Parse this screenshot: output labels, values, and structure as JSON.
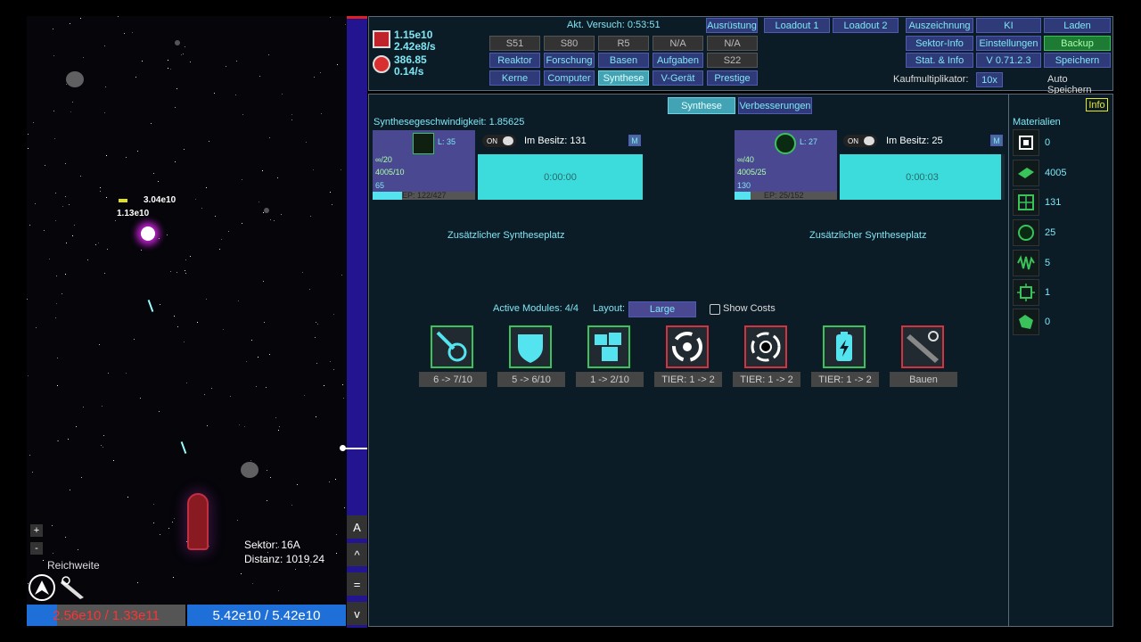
{
  "game": {
    "enemy_value1": "3.04e10",
    "enemy_value2": "1.13e10",
    "sector": "Sektor: 16A",
    "distance": "Distanz: 1019.24",
    "range_label": "Reichweite",
    "plus": "+",
    "minus": "-",
    "enemy_hp": "2.56e10 / 1.33e11",
    "player_hp": "5.42e10 / 5.42e10",
    "side_buttons": [
      "A",
      "^",
      "=",
      "v"
    ]
  },
  "header": {
    "resource1_value": "1.15e10",
    "resource1_rate": "2.42e8/s",
    "resource2_value": "386.85",
    "resource2_rate": "0.14/s",
    "attempt": "Akt. Versuch: 0:53:51",
    "buy_multiplier_label": "Kaufmultiplikator:",
    "buy_multiplier_value": "10x",
    "auto_save": "Auto Speichern",
    "slots_row1": [
      "S51",
      "S80",
      "R5",
      "N/A",
      "N/A"
    ],
    "nav_row2": [
      "Reaktor",
      "Forschung",
      "Basen",
      "Aufgaben"
    ],
    "slot_s22": "S22",
    "nav_row3": [
      "Kerne",
      "Computer",
      "Synthese",
      "V-Gerät",
      "Prestige"
    ],
    "equipment": "Ausrüstung",
    "loadout1": "Loadout 1",
    "loadout2": "Loadout 2",
    "right_buttons": [
      "Auszeichnung",
      "KI",
      "Laden",
      "Sektor-Info",
      "Einstellungen",
      "Backup",
      "Stat. & Info",
      "V 0.71.2.3",
      "Speichern"
    ]
  },
  "synthesis": {
    "tab_synthesis": "Synthese",
    "tab_upgrades": "Verbesserungen",
    "info": "Info",
    "speed": "Synthesegeschwindigkeit: 1.85625",
    "slots": [
      {
        "level": "L: 35",
        "toggle": "ON",
        "owned": "Im Besitz: 131",
        "m": "M",
        "req1": "∞/20",
        "req2": "4005/10",
        "req3": "65",
        "ep": "EP: 122/427",
        "ep_fraction": 0.29,
        "timer": "0:00:00",
        "progress": 0.0
      },
      {
        "level": "L: 27",
        "toggle": "ON",
        "owned": "Im Besitz: 25",
        "m": "M",
        "req1": "∞/40",
        "req2": "4005/25",
        "req3": "130",
        "ep": "EP: 25/152",
        "ep_fraction": 0.16,
        "timer": "0:00:03",
        "progress": 0.98
      }
    ],
    "extra_slot": "Zusätzlicher Syntheseplatz",
    "active_modules": "Active Modules: 4/4",
    "layout_label": "Layout:",
    "layout_value": "Large",
    "show_costs": "Show Costs",
    "modules": [
      {
        "icon": "comet-icon",
        "label": "6 -> 7/10",
        "border": "green"
      },
      {
        "icon": "shield-icon",
        "label": "5 -> 6/10",
        "border": "green"
      },
      {
        "icon": "crystals-icon",
        "label": "1 -> 2/10",
        "border": "green"
      },
      {
        "icon": "vortex-icon",
        "label": "TIER: 1 -> 2",
        "border": "red"
      },
      {
        "icon": "blackhole-icon",
        "label": "TIER: 1 -> 2",
        "border": "red"
      },
      {
        "icon": "battery-icon",
        "label": "TIER: 1 -> 2",
        "border": "green"
      },
      {
        "icon": "weapon-icon",
        "label": "Bauen",
        "border": "red"
      }
    ]
  },
  "materials": {
    "title": "Materialien",
    "items": [
      {
        "icon": "chip-icon",
        "value": "0"
      },
      {
        "icon": "plate-icon",
        "value": "4005"
      },
      {
        "icon": "circuit-icon",
        "value": "131"
      },
      {
        "icon": "orb-icon",
        "value": "25"
      },
      {
        "icon": "wave-icon",
        "value": "5"
      },
      {
        "icon": "board-icon",
        "value": "1"
      },
      {
        "icon": "fragment-icon",
        "value": "0"
      }
    ]
  }
}
